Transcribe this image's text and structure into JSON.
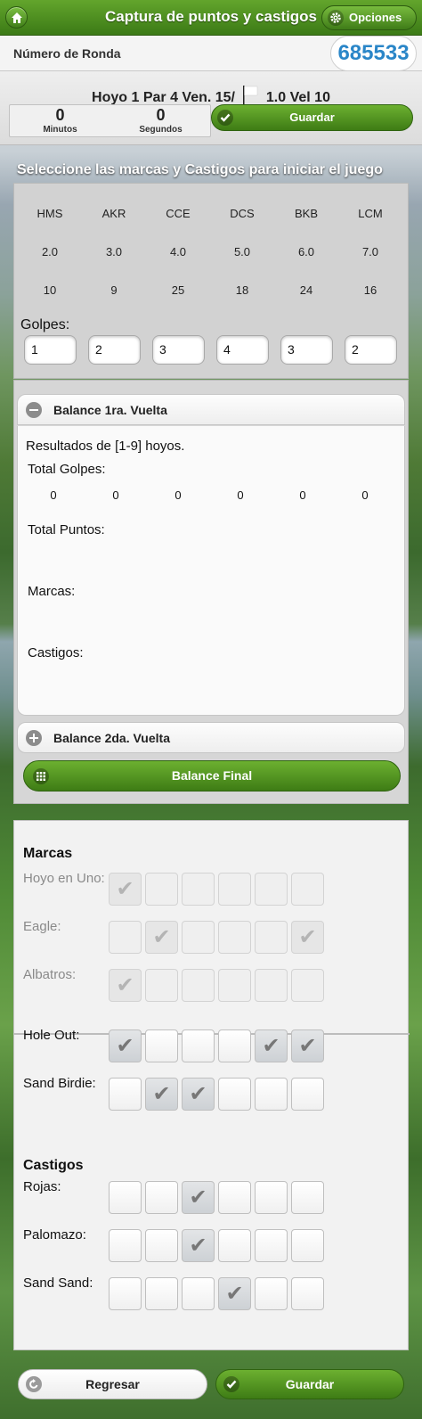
{
  "header": {
    "title": "Captura de puntos y castigos",
    "home_icon": "home-icon",
    "options_label": "Opciones",
    "options_icon": "gear-icon"
  },
  "ronda": {
    "label": "Número de Ronda",
    "value": "685533"
  },
  "hoyo": {
    "text_a": "Hoyo 1 Par 4 Ven. 15/",
    "text_b": "1.0 Vel 10",
    "flag_icon": "flag-icon"
  },
  "timer": {
    "minutes": "0",
    "minutes_label": "Minutos",
    "seconds": "0",
    "seconds_label": "Segundos"
  },
  "save_top": {
    "label": "Guardar",
    "icon": "check-icon"
  },
  "select_title": "Seleccione las marcas y Castigos para iniciar el juego",
  "players": {
    "names": [
      "HMS",
      "AKR",
      "CCE",
      "DCS",
      "BKB",
      "LCM"
    ],
    "handicaps": [
      "2.0",
      "3.0",
      "4.0",
      "5.0",
      "6.0",
      "7.0"
    ],
    "values": [
      "10",
      "9",
      "25",
      "18",
      "24",
      "16"
    ],
    "golpes_label": "Golpes:",
    "golpes": [
      "1",
      "2",
      "3",
      "4",
      "3",
      "2"
    ]
  },
  "balance1": {
    "title": "Balance 1ra. Vuelta",
    "results": "Resultados de [1-9] hoyos.",
    "total_golpes_label": "Total Golpes:",
    "total_golpes": [
      "0",
      "0",
      "0",
      "0",
      "0",
      "0"
    ],
    "total_puntos_label": "Total Puntos:",
    "marcas_label": "Marcas:",
    "castigos_label": "Castigos:"
  },
  "balance2": {
    "title": "Balance 2da. Vuelta"
  },
  "balance_final": {
    "label": "Balance Final",
    "icon": "grid-icon"
  },
  "marcas": {
    "title": "Marcas",
    "rows": [
      {
        "label": "Hoyo en Uno:",
        "enabled": false,
        "checks": [
          true,
          false,
          false,
          false,
          false,
          false
        ]
      },
      {
        "label": "Eagle:",
        "enabled": false,
        "checks": [
          false,
          true,
          false,
          false,
          false,
          true
        ]
      },
      {
        "label": "Albatros:",
        "enabled": false,
        "checks": [
          true,
          false,
          false,
          false,
          false,
          false
        ]
      },
      {
        "label": "Hole Out:",
        "enabled": true,
        "checks": [
          true,
          false,
          false,
          false,
          true,
          true
        ]
      },
      {
        "label": "Sand Birdie:",
        "enabled": true,
        "checks": [
          false,
          true,
          true,
          false,
          false,
          false
        ]
      }
    ]
  },
  "castigos": {
    "title": "Castigos",
    "rows": [
      {
        "label": "Rojas:",
        "enabled": true,
        "checks": [
          false,
          false,
          true,
          false,
          false,
          false
        ]
      },
      {
        "label": "Palomazo:",
        "enabled": true,
        "checks": [
          false,
          false,
          true,
          false,
          false,
          false
        ]
      },
      {
        "label": "Sand Sand:",
        "enabled": true,
        "checks": [
          false,
          false,
          false,
          true,
          false,
          false
        ]
      }
    ]
  },
  "footer": {
    "back_label": "Regresar",
    "back_icon": "back-icon",
    "save_label": "Guardar",
    "save_icon": "check-icon"
  },
  "colors": {
    "accent_green": "#4f8f22",
    "number_blue": "#2a86c8"
  }
}
